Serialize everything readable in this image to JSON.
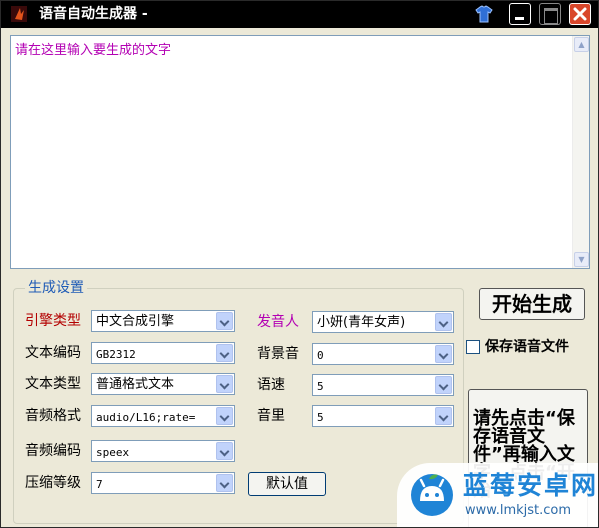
{
  "window": {
    "title": "语音自动生成器 -"
  },
  "editor": {
    "placeholder": "请在这里输入要生成的文字",
    "value": ""
  },
  "settings": {
    "legend": "生成设置",
    "engine_type": {
      "label": "引擎类型",
      "value": "中文合成引擎"
    },
    "text_encoding": {
      "label": "文本编码",
      "value": "GB2312"
    },
    "text_type": {
      "label": "文本类型",
      "value": "普通格式文本"
    },
    "audio_format": {
      "label": "音频格式",
      "value": "audio/L16;rate="
    },
    "audio_encoding": {
      "label": "音频编码",
      "value": "speex"
    },
    "compression_level": {
      "label": "压缩等级",
      "value": "7"
    },
    "speaker": {
      "label": "发音人",
      "value": "小妍(青年女声)"
    },
    "background_sound": {
      "label": "背景音",
      "value": "0"
    },
    "speed": {
      "label": "语速",
      "value": "5"
    },
    "volume": {
      "label": "音里",
      "value": "5"
    },
    "default_button": "默认值"
  },
  "actions": {
    "start_button": "开始生成",
    "save_audio_checkbox": {
      "label": "保存语音文件",
      "checked": false
    },
    "hint": "请先点击“保存语音文件”再输入文字，点击“开始"
  },
  "watermark": {
    "name": "蓝莓安卓网",
    "url": "www.lmkjst.com"
  },
  "colors": {
    "title_bar": "#000000",
    "legend": "#1f5bb6",
    "accent_red": "#b30000",
    "accent_purple": "#b300b3",
    "window_bg": "#ece9d8"
  },
  "icons": [
    "app-icon",
    "shirt-icon",
    "minimize-icon",
    "maximize-icon",
    "close-icon",
    "chevron-down-icon",
    "watermark-logo"
  ]
}
